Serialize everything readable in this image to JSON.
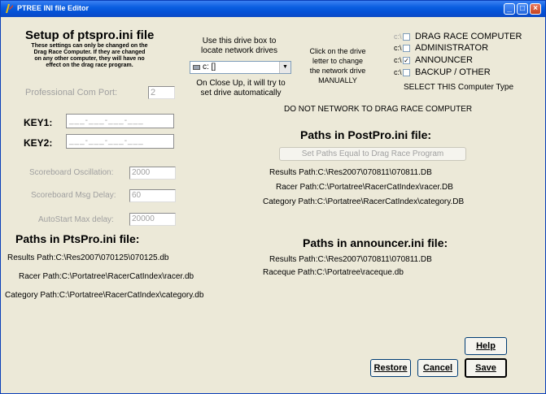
{
  "window": {
    "title": "PTREE INI file Editor",
    "minimize": "_",
    "maximize": "□",
    "close": "×"
  },
  "setup": {
    "heading": "Setup of ptspro.ini file",
    "note_lines": [
      "These settings can only be changed on the",
      "Drag Race Computer.  If they are changed",
      "on any other computer, they will have no",
      "effect on the drag race program."
    ],
    "com_port_label": "Professional Com Port:",
    "com_port_value": "2",
    "key1_label": "KEY1:",
    "key1_value": "___-___-___-___",
    "key2_label": "KEY2:",
    "key2_value": "___-___-___-___",
    "osc_label": "Scoreboard Oscillation:",
    "osc_value": "2000",
    "msg_delay_label": "Scoreboard Msg Delay:",
    "msg_delay_value": "60",
    "autostart_label": "AutoStart Max delay:",
    "autostart_value": "20000"
  },
  "drive": {
    "hint_line1": "Use this drive box to",
    "hint_line2": "locate network drives",
    "selected": "c: []",
    "close_line1": "On Close Up, it will try to",
    "close_line2": "set drive automatically"
  },
  "computer_type": {
    "click_line1": "Click on the drive",
    "click_line2": "letter to change",
    "click_line3": "the network drive",
    "click_line4": "MANUALLY",
    "options": [
      {
        "drive": "c:\\",
        "label": "DRAG RACE COMPUTER",
        "checked": false
      },
      {
        "drive": "c:\\",
        "label": "ADMINISTRATOR",
        "checked": false
      },
      {
        "drive": "c:\\",
        "label": "ANNOUNCER",
        "checked": true
      },
      {
        "drive": "c:\\",
        "label": "BACKUP / OTHER",
        "checked": false
      }
    ],
    "select_label": "SELECT THIS Computer Type",
    "check_mark": "✓"
  },
  "warning": "DO NOT NETWORK TO DRAG RACE COMPUTER",
  "postpro": {
    "heading": "Paths in PostPro.ini file:",
    "set_paths_button": "Set Paths Equal to Drag Race Program",
    "results": "Results Path:C:\\Res2007\\070811\\070811.DB",
    "racer": "Racer Path:C:\\Portatree\\RacerCatIndex\\racer.DB",
    "category": "Category Path:C:\\Portatree\\RacerCatIndex\\category.DB"
  },
  "ptspro": {
    "heading": "Paths in PtsPro.ini file:",
    "results": "Results Path:C:\\Res2007\\070125\\070125.db",
    "racer": "Racer Path:C:\\Portatree\\RacerCatIndex\\racer.db",
    "category": "Category Path:C:\\Portatree\\RacerCatIndex\\category.db"
  },
  "announcer": {
    "heading": "Paths in announcer.ini file:",
    "results": "Results Path:C:\\Res2007\\070811\\070811.DB",
    "raceque": "Raceque Path:C:\\Portatree\\raceque.db"
  },
  "buttons": {
    "help": "Help",
    "restore": "Restore",
    "cancel": "Cancel",
    "save": "Save"
  }
}
